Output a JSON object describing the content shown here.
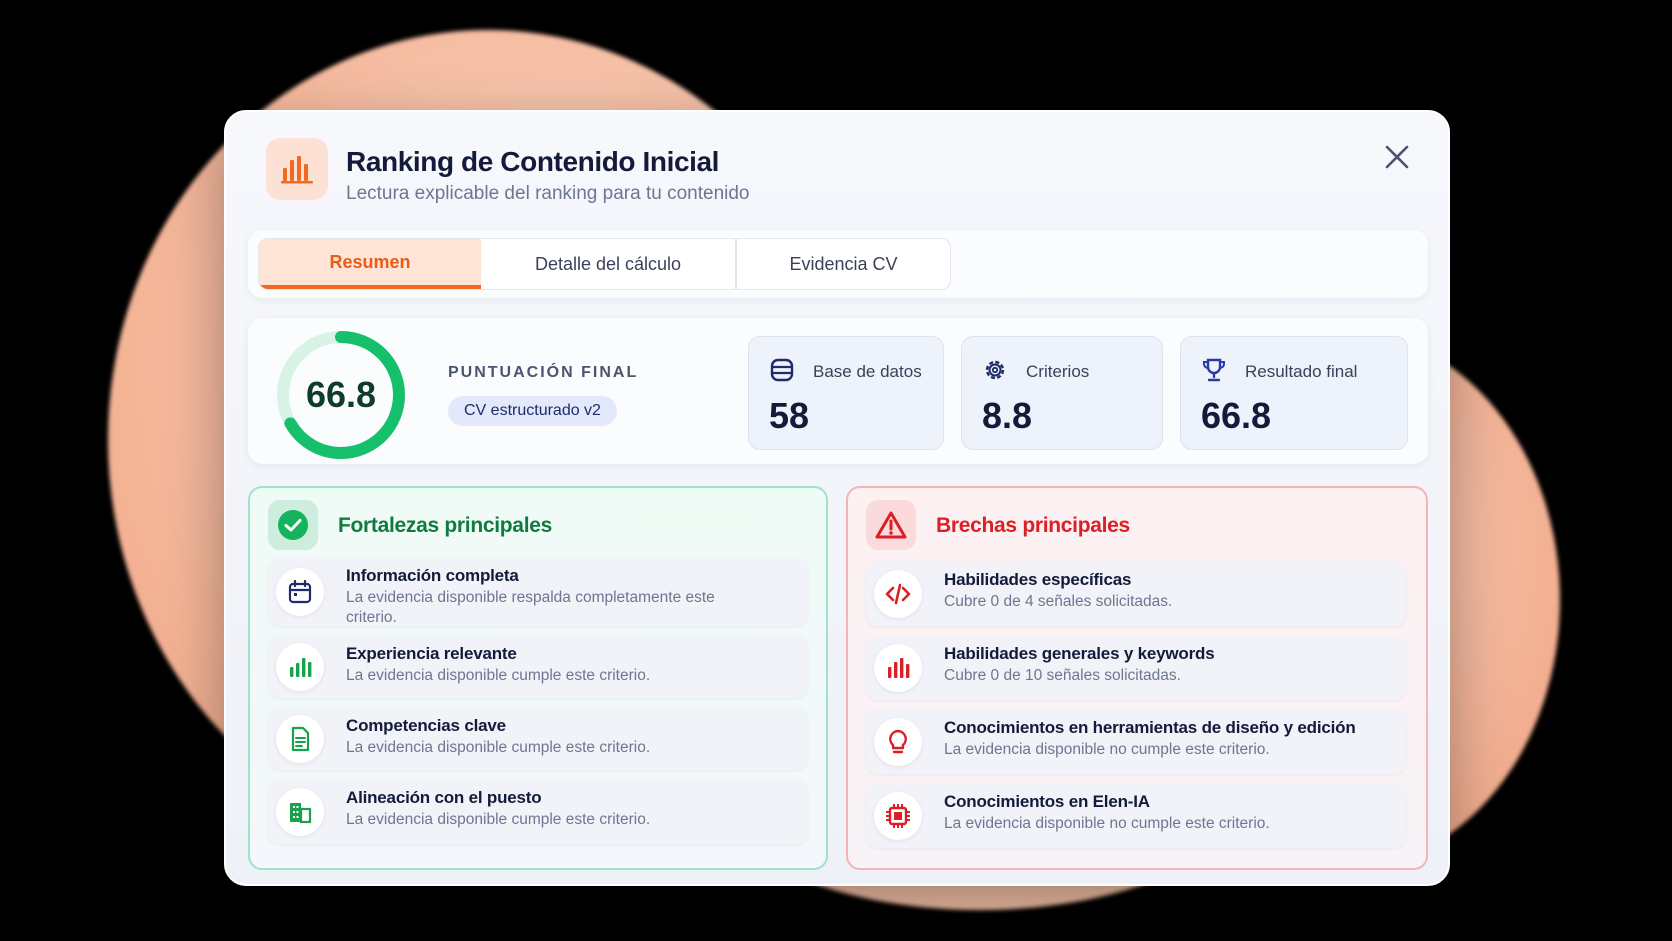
{
  "modal": {
    "title": "Ranking de Contenido Inicial",
    "subtitle": "Lectura explicable del ranking para tu contenido",
    "close_label": "×"
  },
  "tabs": [
    {
      "label": "Resumen",
      "active": true
    },
    {
      "label": "Detalle del cálculo",
      "active": false
    },
    {
      "label": "Evidencia CV",
      "active": false
    }
  ],
  "score": {
    "value": "66.8",
    "fraction": 0.668,
    "label": "PUNTUACIÓN FINAL",
    "badge": "CV estructurado v2"
  },
  "stats": [
    {
      "icon": "database-icon",
      "label": "Base de datos",
      "value": "58"
    },
    {
      "icon": "gear-icon",
      "label": "Criterios",
      "value": "8.8"
    },
    {
      "icon": "trophy-icon",
      "label": "Resultado final",
      "value": "66.8"
    }
  ],
  "strengths": {
    "title": "Fortalezas principales",
    "items": [
      {
        "icon": "calendar-icon",
        "title": "Información completa",
        "desc": "La evidencia disponible respalda completamente este criterio."
      },
      {
        "icon": "bar-chart-icon",
        "title": "Experiencia relevante",
        "desc": "La evidencia disponible cumple este criterio."
      },
      {
        "icon": "document-icon",
        "title": "Competencias clave",
        "desc": "La evidencia disponible cumple este criterio."
      },
      {
        "icon": "building-icon",
        "title": "Alineación con el puesto",
        "desc": "La evidencia disponible cumple este criterio."
      }
    ]
  },
  "gaps": {
    "title": "Brechas principales",
    "items": [
      {
        "icon": "code-icon",
        "title": "Habilidades específicas",
        "desc": "Cubre 0 de 4 señales solicitadas."
      },
      {
        "icon": "bar-chart-icon",
        "title": "Habilidades generales y keywords",
        "desc": "Cubre 0 de 10 señales solicitadas."
      },
      {
        "icon": "lightbulb-icon",
        "title": "Conocimientos en herramientas de diseño y edición",
        "desc": "La evidencia disponible no cumple este criterio."
      },
      {
        "icon": "chip-icon",
        "title": "Conocimientos en Elen-IA",
        "desc": "La evidencia disponible no cumple este criterio."
      }
    ]
  },
  "colors": {
    "accent": "#f06a22",
    "green": "#16c06a",
    "red": "#dc1f25",
    "navy": "#1f2b6b"
  }
}
